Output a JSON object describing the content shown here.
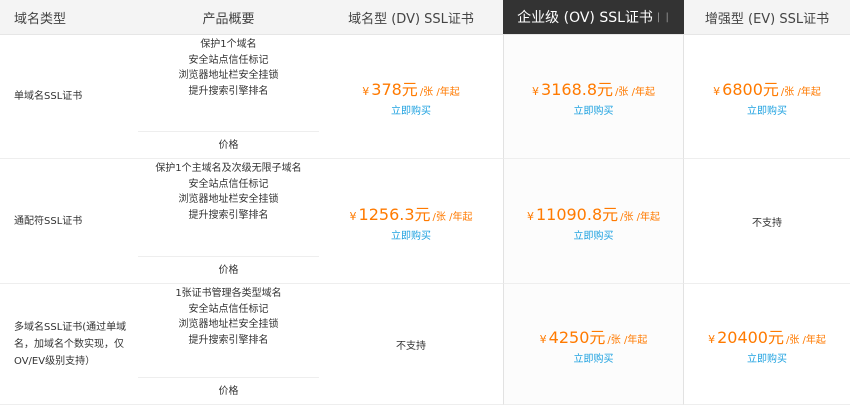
{
  "header": {
    "col_type": "域名类型",
    "col_overview": "产品概要",
    "col_dv": "域名型 (DV) SSL证书",
    "col_ov": "企业级 (OV) SSL证书",
    "col_ov_tail": "| |",
    "col_ev": "增强型 (EV) SSL证书"
  },
  "rows": [
    {
      "name": "单域名SSL证书",
      "features": [
        "保护1个域名",
        "安全站点信任标记",
        "浏览器地址栏安全挂锁",
        "提升搜索引擎排名"
      ],
      "price_label": "价格",
      "dv": {
        "currency": "¥",
        "amount": "378元",
        "unit": "/张 /年起",
        "buy": "立即购买"
      },
      "ov": {
        "currency": "¥",
        "amount": "3168.8元",
        "unit": "/张 /年起",
        "buy": "立即购买"
      },
      "ev": {
        "currency": "¥",
        "amount": "6800元",
        "unit": "/张 /年起",
        "buy": "立即购买"
      }
    },
    {
      "name": "通配符SSL证书",
      "features": [
        "保护1个主域名及次级无限子域名",
        "安全站点信任标记",
        "浏览器地址栏安全挂锁",
        "提升搜索引擎排名"
      ],
      "price_label": "价格",
      "dv": {
        "currency": "¥",
        "amount": "1256.3元",
        "unit": "/张 /年起",
        "buy": "立即购买"
      },
      "ov": {
        "currency": "¥",
        "amount": "11090.8元",
        "unit": "/张 /年起",
        "buy": "立即购买"
      },
      "ev_unsupported": "不支持"
    },
    {
      "name": "多域名SSL证书(通过单域名，加域名个数实现，仅OV/EV级别支持）",
      "features": [
        "1张证书管理各类型域名",
        "安全站点信任标记",
        "浏览器地址栏安全挂锁",
        "提升搜索引擎排名"
      ],
      "price_label": "价格",
      "dv_unsupported": "不支持",
      "ov": {
        "currency": "¥",
        "amount": "4250元",
        "unit": "/张 /年起",
        "buy": "立即购买"
      },
      "ev": {
        "currency": "¥",
        "amount": "20400元",
        "unit": "/张 /年起",
        "buy": "立即购买"
      }
    }
  ],
  "colors": {
    "price": "#ff7a00",
    "link": "#1fa2e0",
    "ov_header_bg": "#333333"
  }
}
